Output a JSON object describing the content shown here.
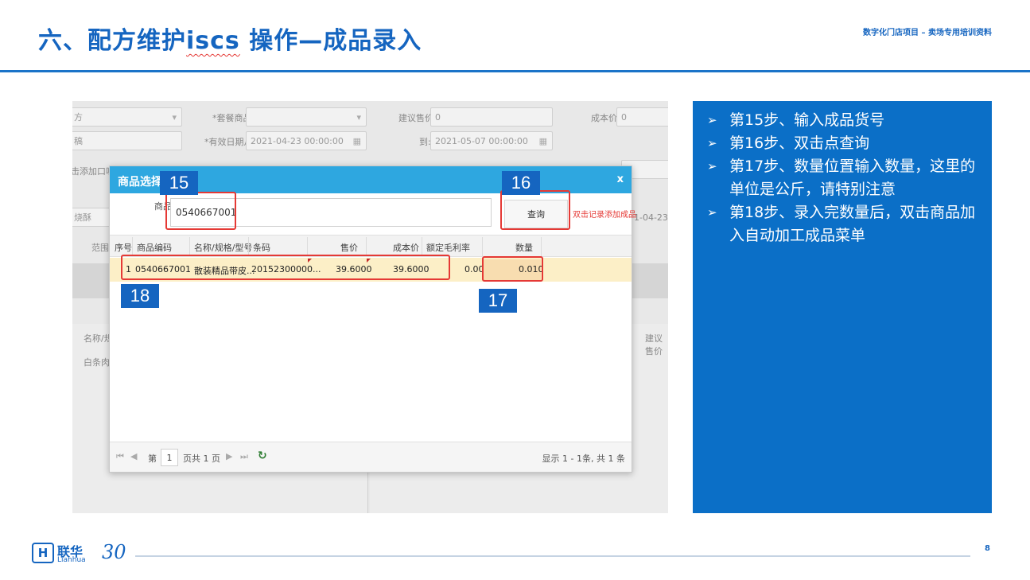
{
  "slide": {
    "title_prefix": "六、配方维护",
    "title_wavy": "iscs",
    "title_suffix": " 操作—成品录入",
    "subtitle": "数字化门店项目 – 卖场专用培训资料",
    "page_number": "8"
  },
  "background_form": {
    "field_a": "方",
    "field_b": "稿",
    "field_c": "击添加口味",
    "field_d": "烧酥",
    "label_set_item": "*套餐商品:",
    "label_suggest_price": "建议售价:",
    "suggest_price_value": "0",
    "label_cost_price": "成本价:",
    "cost_price_value": "0",
    "label_valid_from": "*有效日期从:",
    "valid_from_value": "2021-04-23 00:00:00",
    "label_to": "到:",
    "valid_to_value": "2021-05-07 00:00:00",
    "right_date_fragment": "1-04-23 17",
    "label_scope": "范围",
    "col_name": "名称/规",
    "col_suggest": "建议售价",
    "row_text": "白条肉戴"
  },
  "dialog": {
    "title": "商品选择",
    "close": "x",
    "search_label": "商品",
    "search_value": "0540667001",
    "query_button": "查询",
    "hint": "双击记录添加成品",
    "columns": [
      "序号",
      "商品编码",
      "名称/规格/型号",
      "条码",
      "售价",
      "成本价",
      "额定毛利率",
      "数量"
    ],
    "row": {
      "index": "1",
      "code": "0540667001",
      "name": "散装精品带皮...",
      "barcode": "20152300000...",
      "price": "39.6000",
      "cost": "39.6000",
      "margin": "0.00",
      "qty": "0.010"
    },
    "pager": {
      "page_prefix": "第",
      "page_value": "1",
      "page_suffix": "页共 1 页",
      "summary": "显示 1 - 1条, 共 1 条"
    }
  },
  "annotations": {
    "tag_15": "15",
    "tag_16": "16",
    "tag_17": "17",
    "tag_18": "18"
  },
  "steps": [
    "第15步、输入成品货号",
    "第16步、双击点查询",
    "第17步、数量位置输入数量，这里的单位是公斤，请特别注意",
    "第18步、录入完数量后，双击商品加入自动加工成品菜单"
  ],
  "logo": {
    "mark": "H",
    "cn": "联华",
    "en": "Lianhua",
    "anniv": "30"
  },
  "colors": {
    "brand_blue": "#1565c0",
    "panel_blue": "#0b6fc7",
    "dialog_header": "#2ea7e0",
    "annotation_red": "#e53935",
    "row_highlight": "#fcefc7"
  }
}
